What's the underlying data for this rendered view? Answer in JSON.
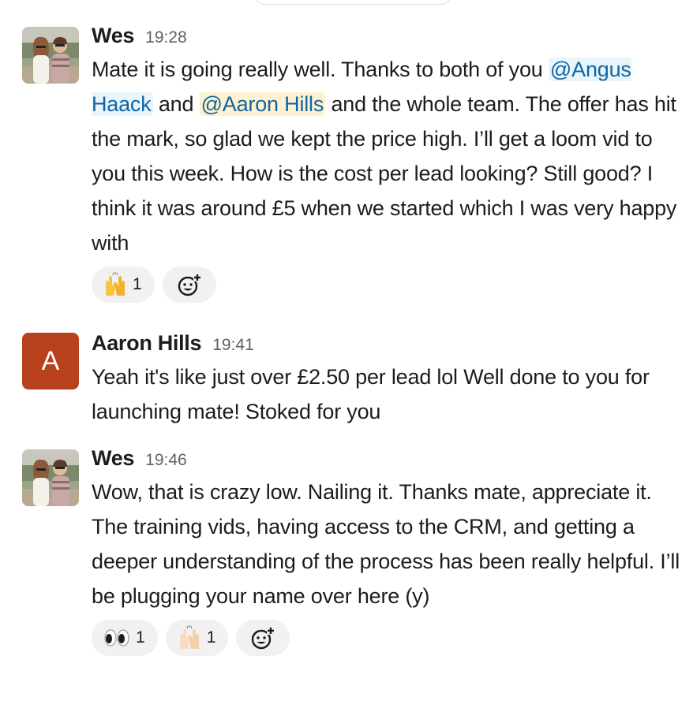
{
  "messages": [
    {
      "sender": "Wes",
      "time": "19:28",
      "body_pre": "Mate it is going really well. Thanks to both of you ",
      "mention1": "@Angus Haack",
      "body_mid": " and ",
      "mention2": "@Aaron Hills",
      "body_post": " and the whole team. The offer has hit the mark, so glad we kept the price high. I’ll get a loom vid to you this week. How is the cost per lead looking? Still good? I think it was around £5 when we started which I was very happy with",
      "reactions": [
        {
          "icon": "raised-hands-icon",
          "count": "1"
        }
      ]
    },
    {
      "sender": "Aaron Hills",
      "avatar_letter": "A",
      "avatar_color": "#b7411d",
      "time": "19:41",
      "body": "Yeah it's like just over £2.50 per lead lol Well done to you for launching mate! Stoked for you"
    },
    {
      "sender": "Wes",
      "time": "19:46",
      "body": "Wow, that is crazy low. Nailing it. Thanks mate, appreciate it. The training vids, having access to the CRM, and getting a deeper understanding of the process has been really helpful. I’ll be plugging your name over here (y)",
      "reactions": [
        {
          "icon": "eyes-icon",
          "count": "1"
        },
        {
          "icon": "raised-hands-light-icon",
          "count": "1"
        }
      ]
    }
  ],
  "colors": {
    "mention_bg": "#e8f5fa",
    "self_mention_bg": "#fdf2cf",
    "mention_text": "#1264a3",
    "reaction_bg": "#f1f1f1"
  }
}
